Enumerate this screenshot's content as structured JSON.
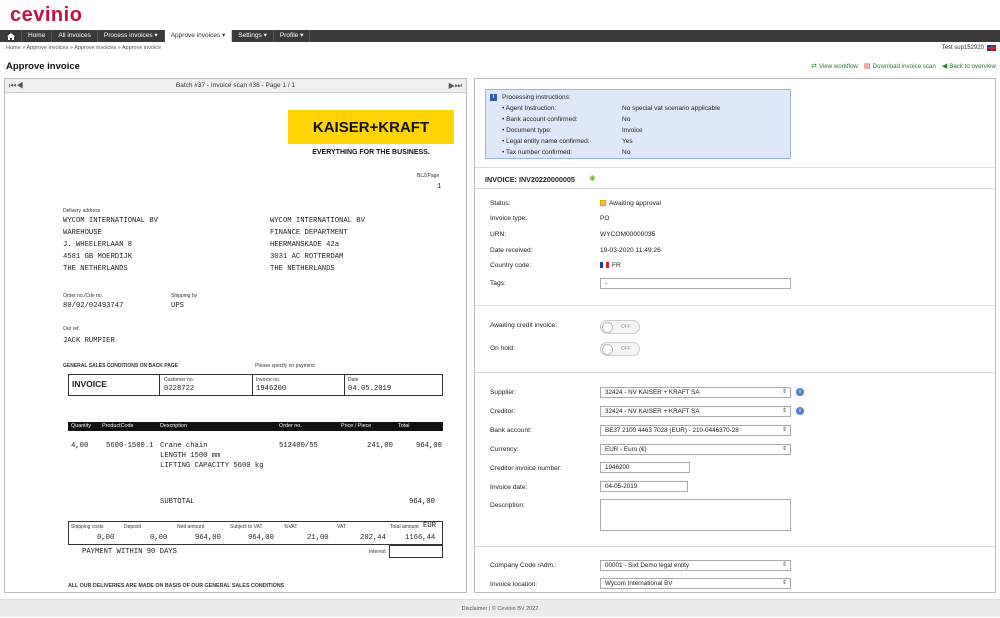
{
  "brand": {
    "logo": "cevinio"
  },
  "nav": {
    "items": [
      "Home",
      "All invoices",
      "Process invoices ▾",
      "Approve invoices ▾",
      "Settings ▾",
      "Profile ▾"
    ]
  },
  "breadcrumb": [
    "Home",
    "Approve invoices",
    "Approve invoices",
    "Approve invoice"
  ],
  "user": {
    "name": "Test sup152920"
  },
  "page": {
    "title": "Approve invoice",
    "actions": {
      "view_workflow": "View workflow",
      "download_scan": "Download invoice scan",
      "back": "Back to overview"
    }
  },
  "scan": {
    "caption": "Batch #37 - Invoice scan #36 - Page 1 / 1",
    "document": {
      "brand": "KAISER+KRAFT",
      "tagline": "EVERYTHING FOR THE BUSINESS.",
      "blz_label": "BLZ/Page",
      "page_no": "1",
      "delivery_label": "Delivery address",
      "delivery": [
        "WYCOM INTERNATIONAL BV",
        "WAREHOUSE",
        "J. WHEELERLAAN 8",
        "4581 GB MOERDIJK",
        "THE NETHERLANDS"
      ],
      "billing": [
        "WYCOM INTERNATIONAL BV",
        "FINANCE DEPARTMENT",
        "HEERMANSKADE 42a",
        "3031 AC ROTTERDAM",
        "THE NETHERLANDS"
      ],
      "order_label": "Order no./Cde no.",
      "order_value": "80/02/02493747",
      "shipping_label": "Shipping by",
      "shipping_value": "UPS",
      "ourref_label": "Our ref.",
      "ourref_value": "JACK RUMPIER",
      "conditions": "GENERAL SALES CONDITIONS ON BACK PAGE",
      "specify": "Please specify on payment",
      "invoice_label": "INVOICE",
      "customer_label": "Customer no.",
      "customer_value": "0228722",
      "invoiceno_label": "Invoice no.",
      "invoiceno_value": "1946200",
      "date_label": "Date",
      "date_value": "04.05.2019",
      "table_headers": [
        "Quantity",
        "ProductCode",
        "Description",
        "Order no.",
        "Price / Piece",
        "Total"
      ],
      "line": {
        "qty": "4,00",
        "code": "5600-1500.1",
        "desc": [
          "Crane chain",
          "LENGTH 1500 mm",
          "LIFTING CAPACITY 5600 kg"
        ],
        "order": "512400/55",
        "price": "241,00",
        "total": "964,00"
      },
      "subtotal_label": "SUBTOTAL",
      "subtotal_value": "964,00",
      "summary_headers": [
        "Shipping costs",
        "Deposit",
        "Nett amount",
        "Subject to VAT",
        "%VAT",
        "VAT",
        "Total amount",
        "EUR"
      ],
      "summary_values": [
        "0,00",
        "0,00",
        "964,00",
        "964,00",
        "21,00",
        "202,44",
        "1166,44"
      ],
      "payment": "PAYMENT WITHIN 90 DAYS",
      "interest_label": "Interest",
      "deliveries": "ALL OUR DELIVERIES ARE MADE ON BASIS OF OUR GENERAL SALES CONDITIONS"
    }
  },
  "instructions": {
    "title": "Processing instructions:",
    "rows": [
      {
        "label": "Agent Instruction:",
        "value": "No special vat scenario applicable"
      },
      {
        "label": "Bank account confirmed:",
        "value": "No"
      },
      {
        "label": "Document type:",
        "value": "Invoice"
      },
      {
        "label": "Legal entity name confirmed:",
        "value": "Yes"
      },
      {
        "label": "Tax number confirmed:",
        "value": "No"
      }
    ]
  },
  "invoice": {
    "heading": "INVOICE: INV20220000005",
    "status_label": "Status:",
    "status_value": "Awaiting approval",
    "type_label": "Invoice type:",
    "type_value": "PO",
    "urn_label": "URN:",
    "urn_value": "WYCOM00000035",
    "received_label": "Date received:",
    "received_value": "19-03-2020 11:49:26",
    "country_label": "Country code:",
    "country_value": "FR",
    "tags_label": "Tags:",
    "tags_value": "-",
    "credit_label": "Awaiting credit invoice:",
    "credit_toggle": "OFF",
    "hold_label": "On hold:",
    "hold_toggle": "OFF",
    "supplier_label": "Supplier:",
    "supplier_value": "32424 - NV KAISER + KRAFT SA",
    "creditor_label": "Creditor:",
    "creditor_value": "32424 - NV KAISER + KRAFT SA",
    "bank_label": "Bank account:",
    "bank_value": "BE37 2100 4463 7028 (EUR) - 210-0446370-28",
    "currency_label": "Currency:",
    "currency_value": "EUR - Euro (€)",
    "creditor_no_label": "Creditor invoice number:",
    "creditor_no_value": "1946200",
    "inv_date_label": "Invoice date:",
    "inv_date_value": "04-05-2019",
    "desc_label": "Description:",
    "company_label": "Company Code /Adm.:",
    "company_value": "00001 - Sixt Demo legal entity",
    "location_label": "Invoice location:",
    "location_value": "Wycom International BV"
  },
  "footer": {
    "text": "Disclaimer | © Cevinio BV 2022"
  },
  "colors": {
    "brand": "#c5103a",
    "nav": "#3a3a3a",
    "accent_green": "#2a7c2a",
    "kaiser_yellow": "#ffd400"
  }
}
